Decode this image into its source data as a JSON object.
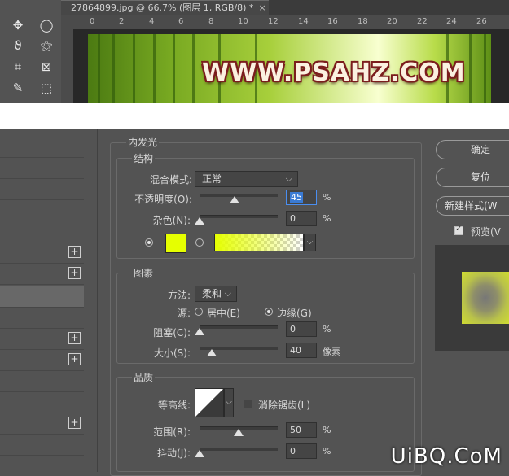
{
  "document": {
    "tab_title": "27864899.jpg @ 66.7% (图层 1, RGB/8) *",
    "tab_close": "×",
    "ruler_marks": [
      "0",
      "2",
      "4",
      "6",
      "8",
      "10",
      "12",
      "14",
      "16",
      "18",
      "20",
      "22",
      "24",
      "26"
    ],
    "banner_text": "WWW.PSAHZ.COM"
  },
  "tools": [
    {
      "name": "move-icon",
      "glyph": "✥"
    },
    {
      "name": "ellipse-marquee-icon",
      "glyph": "◯"
    },
    {
      "name": "lasso-icon",
      "glyph": "ϑ"
    },
    {
      "name": "magic-wand-icon",
      "glyph": "⚝"
    },
    {
      "name": "crop-icon",
      "glyph": "⌗"
    },
    {
      "name": "frame-icon",
      "glyph": "⊠"
    },
    {
      "name": "eyedropper-icon",
      "glyph": "✎"
    },
    {
      "name": "dotted-rect-icon",
      "glyph": "⬚"
    }
  ],
  "dialog": {
    "section_title": "内发光",
    "structure": {
      "title": "结构",
      "blend_mode_label": "混合模式:",
      "blend_mode_value": "正常",
      "opacity_label": "不透明度(O):",
      "opacity_value": "45",
      "opacity_unit": "%",
      "opacity_level": 45,
      "noise_label": "杂色(N):",
      "noise_value": "0",
      "noise_unit": "%",
      "noise_level": 0,
      "glow_color": "#e6ff00"
    },
    "elements": {
      "title": "图素",
      "method_label": "方法:",
      "method_value": "柔和",
      "source_label": "源:",
      "source_center": "居中(E)",
      "source_edge": "边缘(G)",
      "choke_label": "阻塞(C):",
      "choke_value": "0",
      "choke_unit": "%",
      "choke_level": 0,
      "size_label": "大小(S):",
      "size_value": "40",
      "size_unit": "像素",
      "size_level": 16
    },
    "quality": {
      "title": "品质",
      "contour_label": "等高线:",
      "antialias_label": "消除锯齿(L)",
      "range_label": "范围(R):",
      "range_value": "50",
      "range_unit": "%",
      "range_level": 50,
      "jitter_label": "抖动(J):",
      "jitter_value": "0",
      "jitter_unit": "%",
      "jitter_level": 0
    },
    "buttons": {
      "ok": "确定",
      "reset": "复位",
      "new_style": "新建样式(W",
      "preview": "预览(V"
    }
  },
  "watermark": "UiBQ.CoM"
}
